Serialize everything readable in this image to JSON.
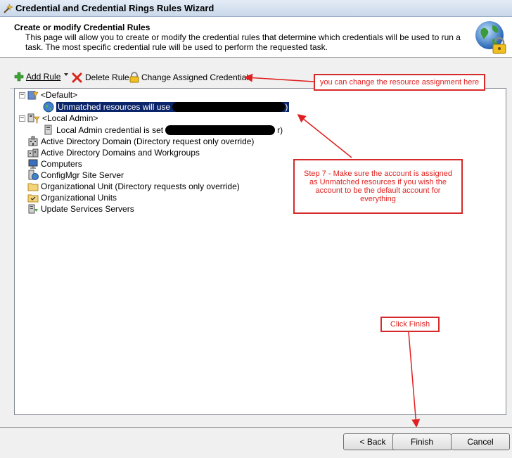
{
  "window": {
    "title": "Credential and Credential Rings Rules Wizard"
  },
  "header": {
    "title": "Create or modify Credential Rules",
    "description": "This page will allow you to create or modify the credential rules that determine which credentials will be used to run a task. The most specific credential rule will be used to perform the requested task."
  },
  "toolbar": {
    "add_rule": "Add Rule",
    "delete_rule": "Delete Rule",
    "change_credential": "Change Assigned Credential"
  },
  "tree": {
    "default": "<Default>",
    "unmatched": "Unmatched resources will use",
    "unmatched_suffix": ")",
    "local_admin": "<Local Admin>",
    "local_admin_child": "Local Admin credential is set",
    "local_admin_suffix": "r)",
    "items": [
      "Active Directory Domain (Directory request only override)",
      "Active Directory Domains and Workgroups",
      "Computers",
      "ConfigMgr Site Server",
      "Organizational Unit (Directory requests only override)",
      "Organizational Units",
      "Update Services Servers"
    ]
  },
  "annotations": {
    "resource_note": "you can change the resource assignment here",
    "step7": "Step 7 - Make sure the account is assigned as Unmatched resources if you wish the account to be the default account for everything",
    "finish_note": "Click Finish",
    "color": "#e02020"
  },
  "buttons": {
    "back": "< Back",
    "finish": "Finish",
    "cancel": "Cancel"
  }
}
